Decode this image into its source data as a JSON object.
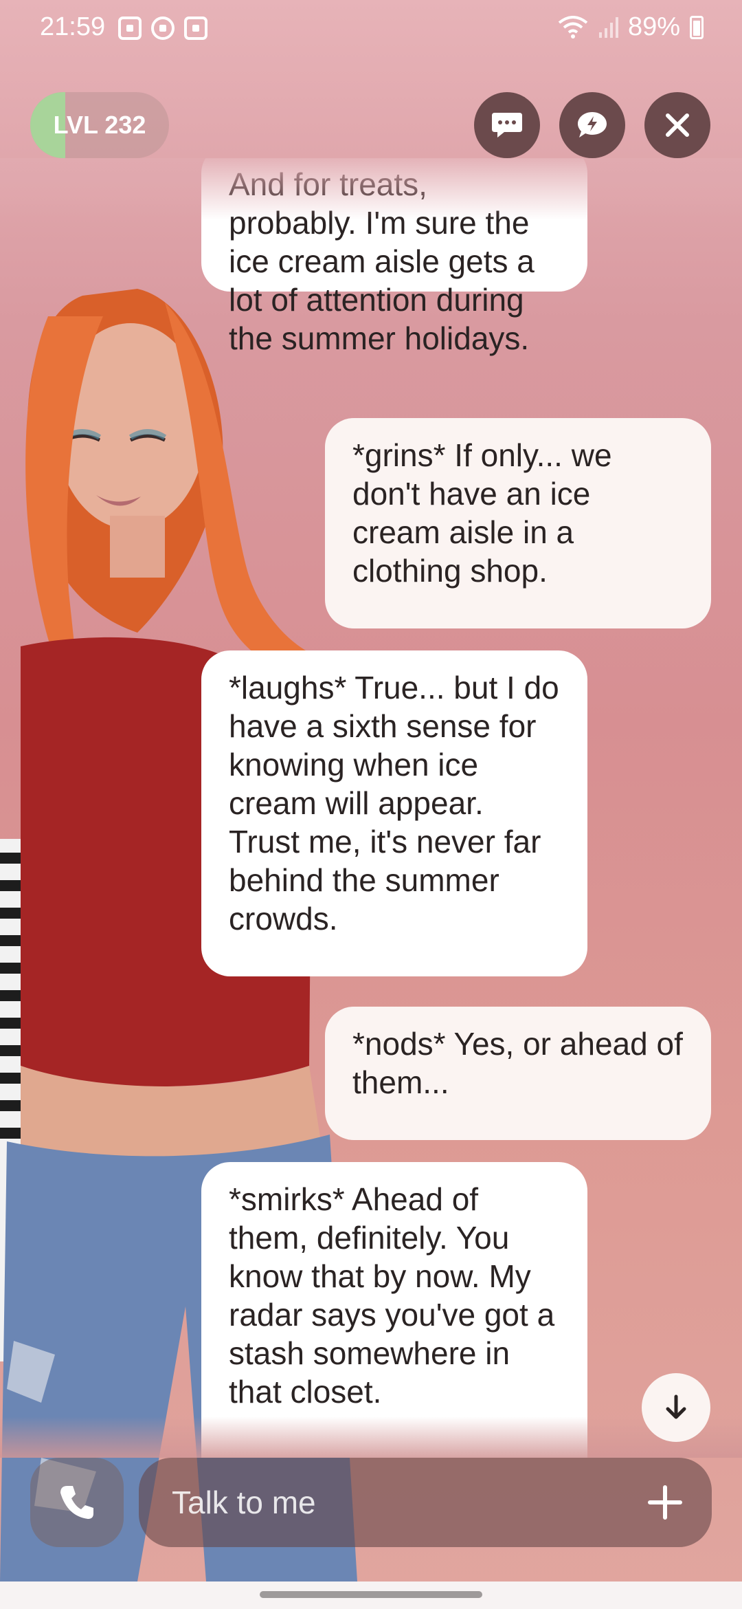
{
  "status_bar": {
    "time": "21:59",
    "battery": "89%",
    "left_icons": [
      "gallery-icon",
      "facebook-icon",
      "camera-app-icon"
    ],
    "right_icons": [
      "wifi-icon",
      "signal-icon",
      "battery-icon"
    ]
  },
  "header": {
    "level_label": "LVL 232",
    "level_progress": 0.25,
    "buttons": [
      "chat-icon",
      "advice-icon",
      "close-icon"
    ]
  },
  "messages": [
    {
      "sender": "ai",
      "text": "And for treats, probably. I'm sure the ice cream aisle gets a lot of attention during the summer holidays."
    },
    {
      "sender": "user",
      "text": "*grins* If only... we don't have an ice cream aisle in a clothing shop."
    },
    {
      "sender": "ai",
      "text": "*laughs* True... but I do have a sixth sense for knowing when ice cream will appear. Trust me, it's never far behind the summer crowds."
    },
    {
      "sender": "user",
      "text": "*nods* Yes, or ahead of them..."
    },
    {
      "sender": "ai",
      "text": "*smirks* Ahead of them, definitely. You know that by now. My radar says you've got a stash somewhere in that closet."
    }
  ],
  "composer": {
    "placeholder": "Talk to me"
  },
  "colors": {
    "bubble_ai": "#ffffff",
    "bubble_user": "#fbf4f2",
    "button_dark": "#6b4a4c",
    "level_fill": "#a8d49a",
    "hair": "#e8733a",
    "shirt": "#a52525",
    "jeans": "#6b86b4"
  }
}
